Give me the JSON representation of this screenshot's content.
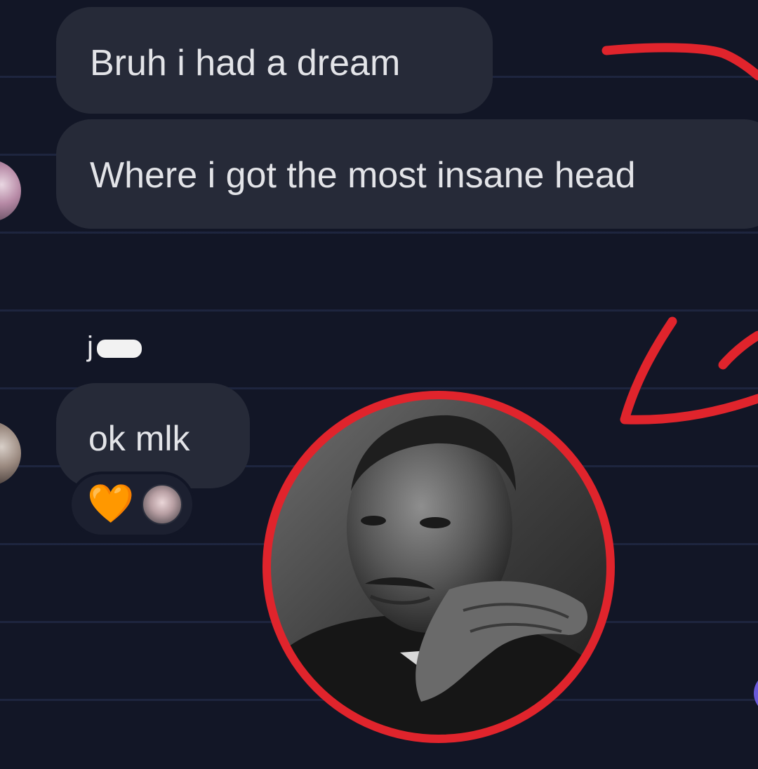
{
  "messages": [
    {
      "text": "Bruh i had a dream"
    },
    {
      "text": "Where i got the most insane head"
    }
  ],
  "reply": {
    "sender_initial": "j",
    "text": "ok mlk",
    "reaction_emoji": "🧡"
  },
  "annotations": {
    "color": "#e0242c"
  }
}
